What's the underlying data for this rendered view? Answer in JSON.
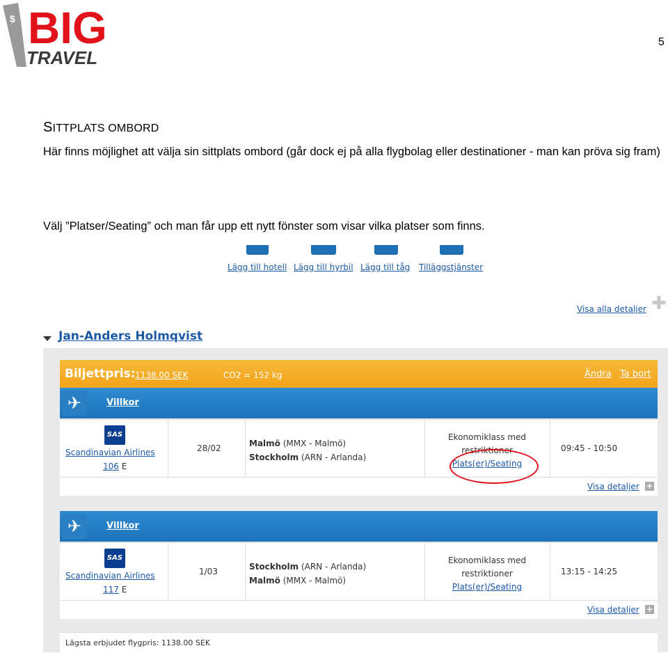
{
  "logo": {
    "line1": "BIG",
    "line2": "TRAVEL",
    "colors": {
      "red": "#e2121b",
      "gray": "#3a3a3a"
    }
  },
  "page_number": "5",
  "doc": {
    "heading_first": "S",
    "heading_rest": "ITTPLATS OMBORD",
    "paragraph1": "Här finns möjlighet att välja sin sittplats ombord (går dock ej på alla flygbolag eller destinationer - man kan pröva sig fram)",
    "paragraph2": "Välj ”Platser/Seating” och man får upp ett nytt fönster som visar vilka platser som finns."
  },
  "toolbar": {
    "add_hotel": "Lägg till hotell",
    "add_car": "Lägg till hyrbil",
    "add_train": "Lägg till tåg",
    "extras": "Tilläggstjänster"
  },
  "show_all_details": "Visa alla detaljer",
  "traveller_name": "Jan-Anders Holmqvist",
  "price_bar": {
    "label": "Biljettpris:",
    "value": "1138.00 SEK",
    "co2": "CO2 = 152 kg",
    "change": "Ändra",
    "remove": "Ta bort"
  },
  "flights": [
    {
      "terms": "Villkor",
      "airline": "Scandinavian Airlines",
      "logo_text": "SAS",
      "flight_number": "106",
      "class_code": "E",
      "date": "28/02",
      "from_city": "Malmö",
      "from_airport": "(MMX - Malmö)",
      "to_city": "Stockholm",
      "to_airport": "(ARN - Arlanda)",
      "class_line1": "Ekonomiklass med",
      "class_line2": "restriktioner",
      "seating": "Plats(er)/Seating",
      "time": "09:45 - 10:50",
      "details": "Visa detaljer"
    },
    {
      "terms": "Villkor",
      "airline": "Scandinavian Airlines",
      "logo_text": "SAS",
      "flight_number": "117",
      "class_code": "E",
      "date": "1/03",
      "from_city": "Stockholm",
      "from_airport": "(ARN - Arlanda)",
      "to_city": "Malmö",
      "to_airport": "(MMX - Malmö)",
      "class_line1": "Ekonomiklass med",
      "class_line2": "restriktioner",
      "seating": "Plats(er)/Seating",
      "time": "13:15 - 14:25",
      "details": "Visa detaljer"
    }
  ],
  "lowest_price": "Lägsta erbjudet flygpris: 1138.00 SEK"
}
